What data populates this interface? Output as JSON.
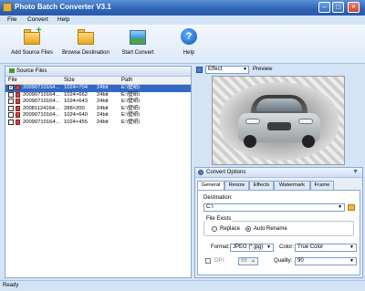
{
  "window": {
    "title": "Photo Batch Converter V3.1"
  },
  "menu": [
    "File",
    "Convert",
    "Help"
  ],
  "toolbar": {
    "add_source": "Add Source Files",
    "browse_destination": "Browse Destination",
    "start_convert": "Start Convert",
    "help": "Help"
  },
  "source_panel": {
    "title": "Source Files",
    "columns": [
      "File",
      "Size",
      "Path"
    ],
    "rows": [
      {
        "file": "20090710164...",
        "size": "1024×704",
        "bits": "24bit",
        "path": "E:\\壁纸\\",
        "checked": true,
        "selected": true
      },
      {
        "file": "20090710164...",
        "size": "1024×662",
        "bits": "24bit",
        "path": "E:\\壁纸\\",
        "checked": false,
        "selected": false
      },
      {
        "file": "20090710164...",
        "size": "1024×643",
        "bits": "24bit",
        "path": "E:\\壁纸\\",
        "checked": false,
        "selected": false
      },
      {
        "file": "20081124164...",
        "size": "288×200",
        "bits": "24bit",
        "path": "E:\\壁纸\\",
        "checked": false,
        "selected": false
      },
      {
        "file": "20090710164...",
        "size": "1024×640",
        "bits": "24bit",
        "path": "E:\\壁纸\\",
        "checked": false,
        "selected": false
      },
      {
        "file": "20090710164...",
        "size": "1024×455",
        "bits": "24bit",
        "path": "E:\\壁纸\\",
        "checked": false,
        "selected": false
      }
    ]
  },
  "preview": {
    "effect_label": "Effect",
    "preview_label": "Preview"
  },
  "options": {
    "title": "Convert Options",
    "tabs": [
      "General",
      "Resize",
      "Effects",
      "Watermark",
      "Frame"
    ],
    "destination_label": "Destination:",
    "destination_value": "C:\\",
    "file_exists_label": "File Exists",
    "replace_label": "Replace",
    "auto_rename_label": "Auto Rename",
    "format_label": "Format:",
    "format_value": "JPEG (*.jpg)",
    "color_label": "Color:",
    "color_value": "True Color",
    "dpi_label": "DPI:",
    "dpi_value": "96",
    "quality_label": "Quality:",
    "quality_value": "90"
  },
  "status": {
    "text": "Ready"
  }
}
